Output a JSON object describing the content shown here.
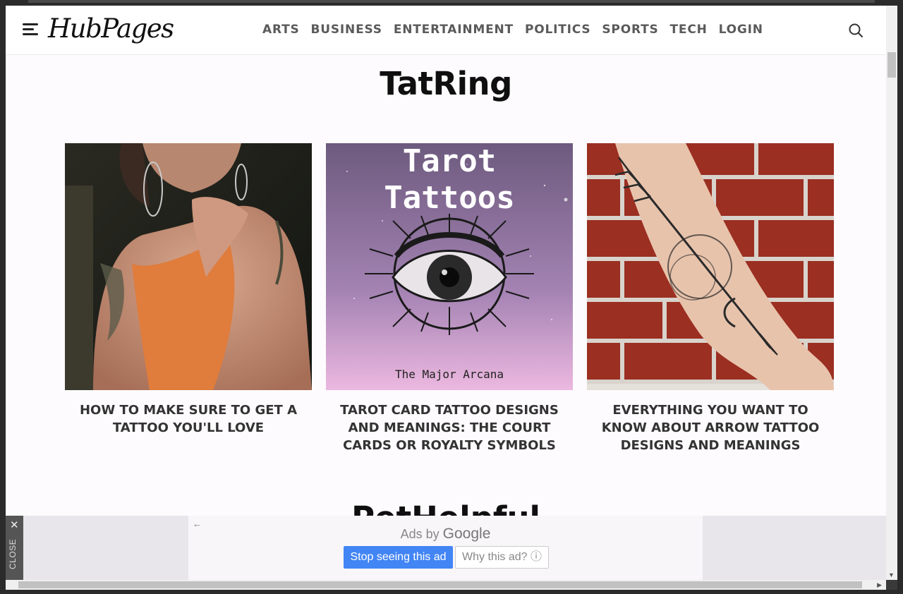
{
  "header": {
    "logo": "HubPages",
    "nav": [
      "ARTS",
      "BUSINESS",
      "ENTERTAINMENT",
      "POLITICS",
      "SPORTS",
      "TECH",
      "LOGIN"
    ]
  },
  "section": {
    "title": "TatRing",
    "cards": [
      {
        "caption": "HOW TO MAKE SURE TO GET A TATTOO YOU'LL LOVE"
      },
      {
        "caption": "TAROT CARD TATTOO DESIGNS AND MEANINGS: THE COURT CARDS OR ROYALTY SYMBOLS",
        "image_text": {
          "line1": "Tarot",
          "line2": "Tattoos",
          "sub": "The Major Arcana"
        }
      },
      {
        "caption": "EVERYTHING YOU WANT TO KNOW ABOUT ARROW TATTOO DESIGNS AND MEANINGS"
      }
    ]
  },
  "next_section": {
    "title_partial": "PetHelpful"
  },
  "ad": {
    "close_label": "CLOSE",
    "ads_by": "Ads by",
    "brand": "Google",
    "stop_label": "Stop seeing this ad",
    "why_label": "Why this ad? ⓘ"
  }
}
